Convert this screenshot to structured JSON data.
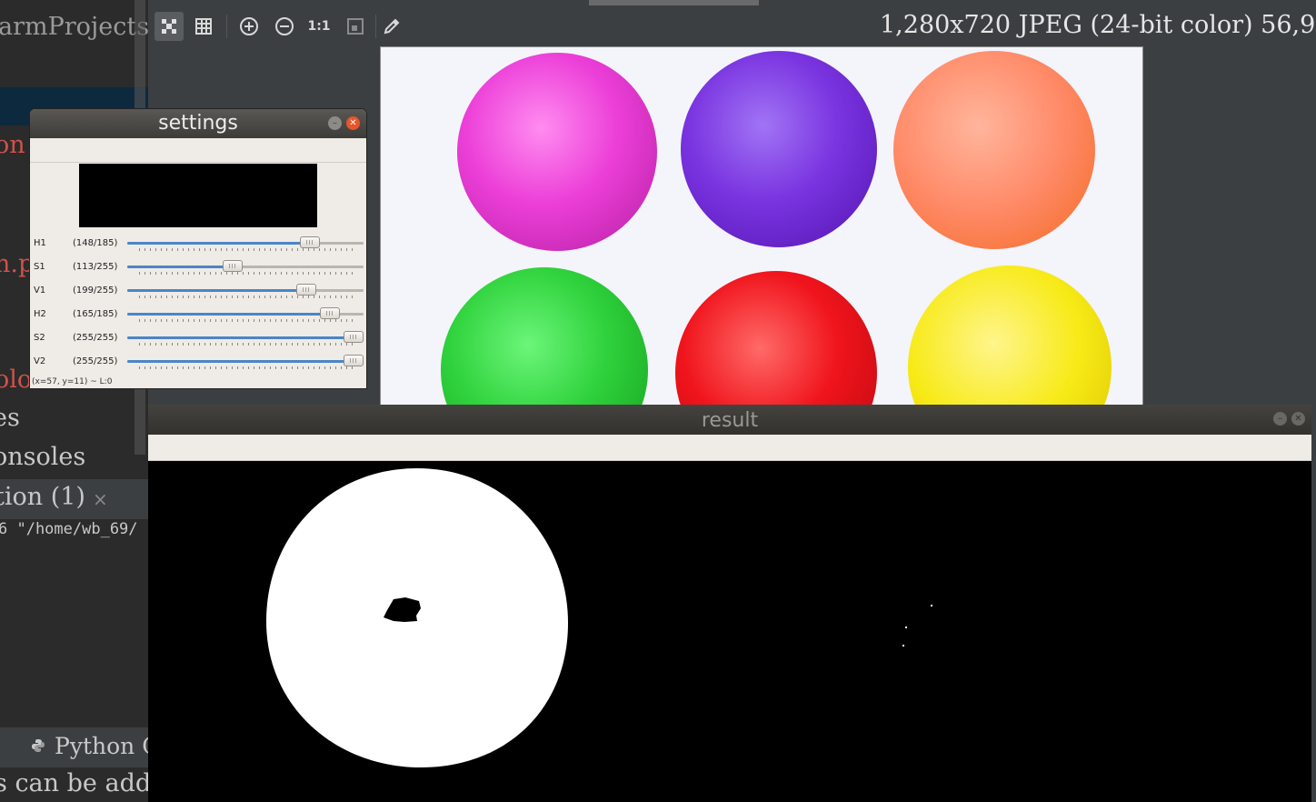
{
  "ide": {
    "project_title": "armProjects",
    "file_fragment_1": "on",
    "file_fragment_2": "n.p",
    "file_fragment_3": "olo",
    "item_es": "es",
    "item_consoles": "onsoles",
    "run_tab": "tion (1)",
    "console_line": "6 \"/home/wb_69/",
    "python_console": "Python C",
    "hint": "s can be add"
  },
  "viewer": {
    "toolbar": {
      "tools": [
        {
          "name": "fit-window",
          "glyph": "▦"
        },
        {
          "name": "grid",
          "glyph": "▦"
        },
        {
          "name": "zoom-in",
          "glyph": "⊕"
        },
        {
          "name": "zoom-out",
          "glyph": "⊖"
        },
        {
          "name": "actual-size",
          "glyph": "1:1"
        },
        {
          "name": "fit",
          "glyph": "▢"
        },
        {
          "name": "color-picker",
          "glyph": "✎"
        }
      ]
    },
    "image_info": "1,280x720 JPEG (24-bit color) 56,9"
  },
  "settings": {
    "title": "settings",
    "trackbars": [
      {
        "name": "H1",
        "label": "(148/185)",
        "value": 148,
        "max": 185
      },
      {
        "name": "S1",
        "label": "(113/255)",
        "value": 113,
        "max": 255
      },
      {
        "name": "V1",
        "label": "(199/255)",
        "value": 199,
        "max": 255
      },
      {
        "name": "H2",
        "label": "(165/185)",
        "value": 165,
        "max": 185
      },
      {
        "name": "S2",
        "label": "(255/255)",
        "value": 255,
        "max": 255
      },
      {
        "name": "V2",
        "label": "(255/255)",
        "value": 255,
        "max": 255
      }
    ],
    "status": "(x=57, y=11) ~ L:0"
  },
  "result": {
    "title": "result"
  },
  "colors": {
    "ball_magenta": "#ec3fd8",
    "ball_purple": "#7a34e0",
    "ball_salmon": "#ff8a68",
    "ball_green": "#2fd23c",
    "ball_red": "#f0141c",
    "ball_yellow": "#f7ea16"
  }
}
